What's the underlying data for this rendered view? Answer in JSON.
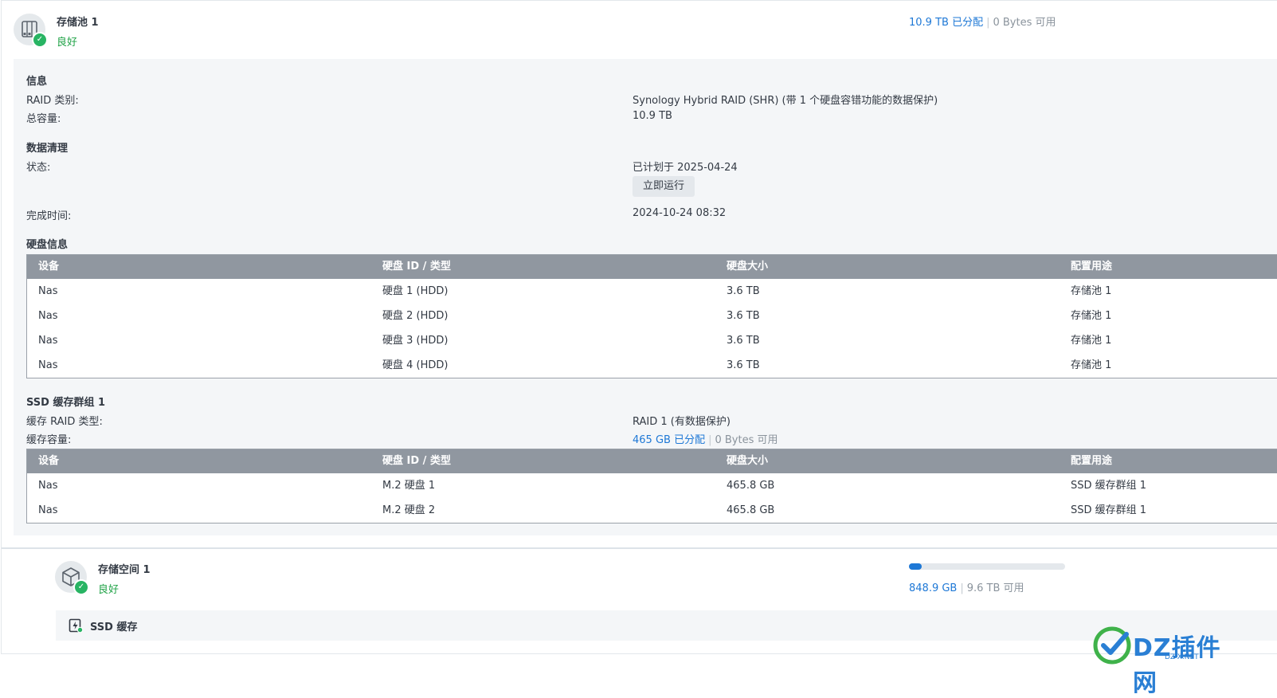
{
  "pool": {
    "title": "存储池 1",
    "status": "良好",
    "allocated": "10.9 TB 已分配",
    "separator": "|",
    "free": "0 Bytes 可用"
  },
  "info": {
    "heading": "信息",
    "raid_label": "RAID 类别:",
    "raid_value": "Synology Hybrid RAID (SHR) (带 1 个硬盘容错功能的数据保护)",
    "capacity_label": "总容量:",
    "capacity_value": "10.9 TB"
  },
  "scrubbing": {
    "heading": "数据清理",
    "status_label": "状态:",
    "status_value": "已计划于 2025-04-24",
    "run_button": "立即运行",
    "completed_label": "完成时间:",
    "completed_value": "2024-10-24 08:32"
  },
  "disk_info": {
    "heading": "硬盘信息",
    "columns": [
      "设备",
      "硬盘 ID / 类型",
      "硬盘大小",
      "配置用途"
    ],
    "rows": [
      [
        "Nas",
        "硬盘 1 (HDD)",
        "3.6 TB",
        "存储池 1"
      ],
      [
        "Nas",
        "硬盘 2 (HDD)",
        "3.6 TB",
        "存储池 1"
      ],
      [
        "Nas",
        "硬盘 3 (HDD)",
        "3.6 TB",
        "存储池 1"
      ],
      [
        "Nas",
        "硬盘 4 (HDD)",
        "3.6 TB",
        "存储池 1"
      ]
    ]
  },
  "ssd_cache_group": {
    "heading": "SSD 缓存群组 1",
    "raid_label": "缓存 RAID 类型:",
    "raid_value": "RAID 1 (有数据保护)",
    "capacity_label": "缓存容量:",
    "allocated": "465 GB 已分配",
    "separator": "|",
    "free": "0 Bytes 可用",
    "columns": [
      "设备",
      "硬盘 ID / 类型",
      "硬盘大小",
      "配置用途"
    ],
    "rows": [
      [
        "Nas",
        "M.2 硬盘 1",
        "465.8 GB",
        "SSD 缓存群组 1"
      ],
      [
        "Nas",
        "M.2 硬盘 2",
        "465.8 GB",
        "SSD 缓存群组 1"
      ]
    ]
  },
  "volume": {
    "title": "存储空间 1",
    "status": "良好",
    "used": "848.9 GB",
    "separator": "|",
    "free": "9.6 TB 可用",
    "usage_fraction": 0.08
  },
  "ssd_cache": {
    "label": "SSD 缓存"
  },
  "watermark": {
    "text": "DZ插件网",
    "sub": "DZ-X.NET"
  },
  "colors": {
    "accent": "#1e78d6",
    "good": "#21a348",
    "table_header": "#9097a0",
    "panel_bg": "#f4f6f8"
  }
}
